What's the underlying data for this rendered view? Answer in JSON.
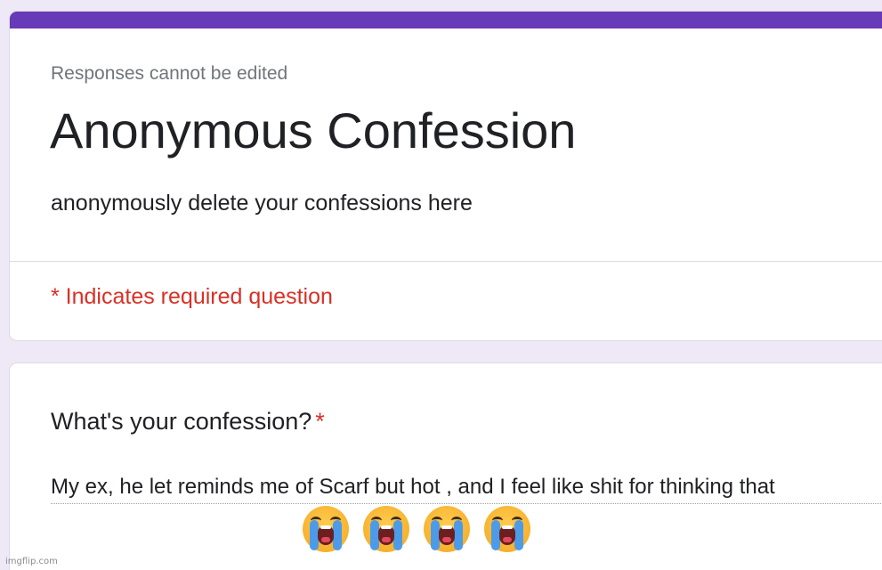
{
  "form": {
    "notice": "Responses cannot be edited",
    "title": "Anonymous Confession",
    "description": "anonymously delete your confessions here",
    "required_note": "* Indicates required question",
    "accent_color": "#673ab7",
    "required_color": "#d93025"
  },
  "question": {
    "title": "What's your confession?",
    "required_marker": "*",
    "answer": "My ex, he let reminds me of Scarf but hot , and I feel like shit for thinking that",
    "emojis": [
      "loudly-crying-face-icon",
      "loudly-crying-face-icon",
      "loudly-crying-face-icon",
      "loudly-crying-face-icon"
    ]
  },
  "watermark": "imgflip.com"
}
